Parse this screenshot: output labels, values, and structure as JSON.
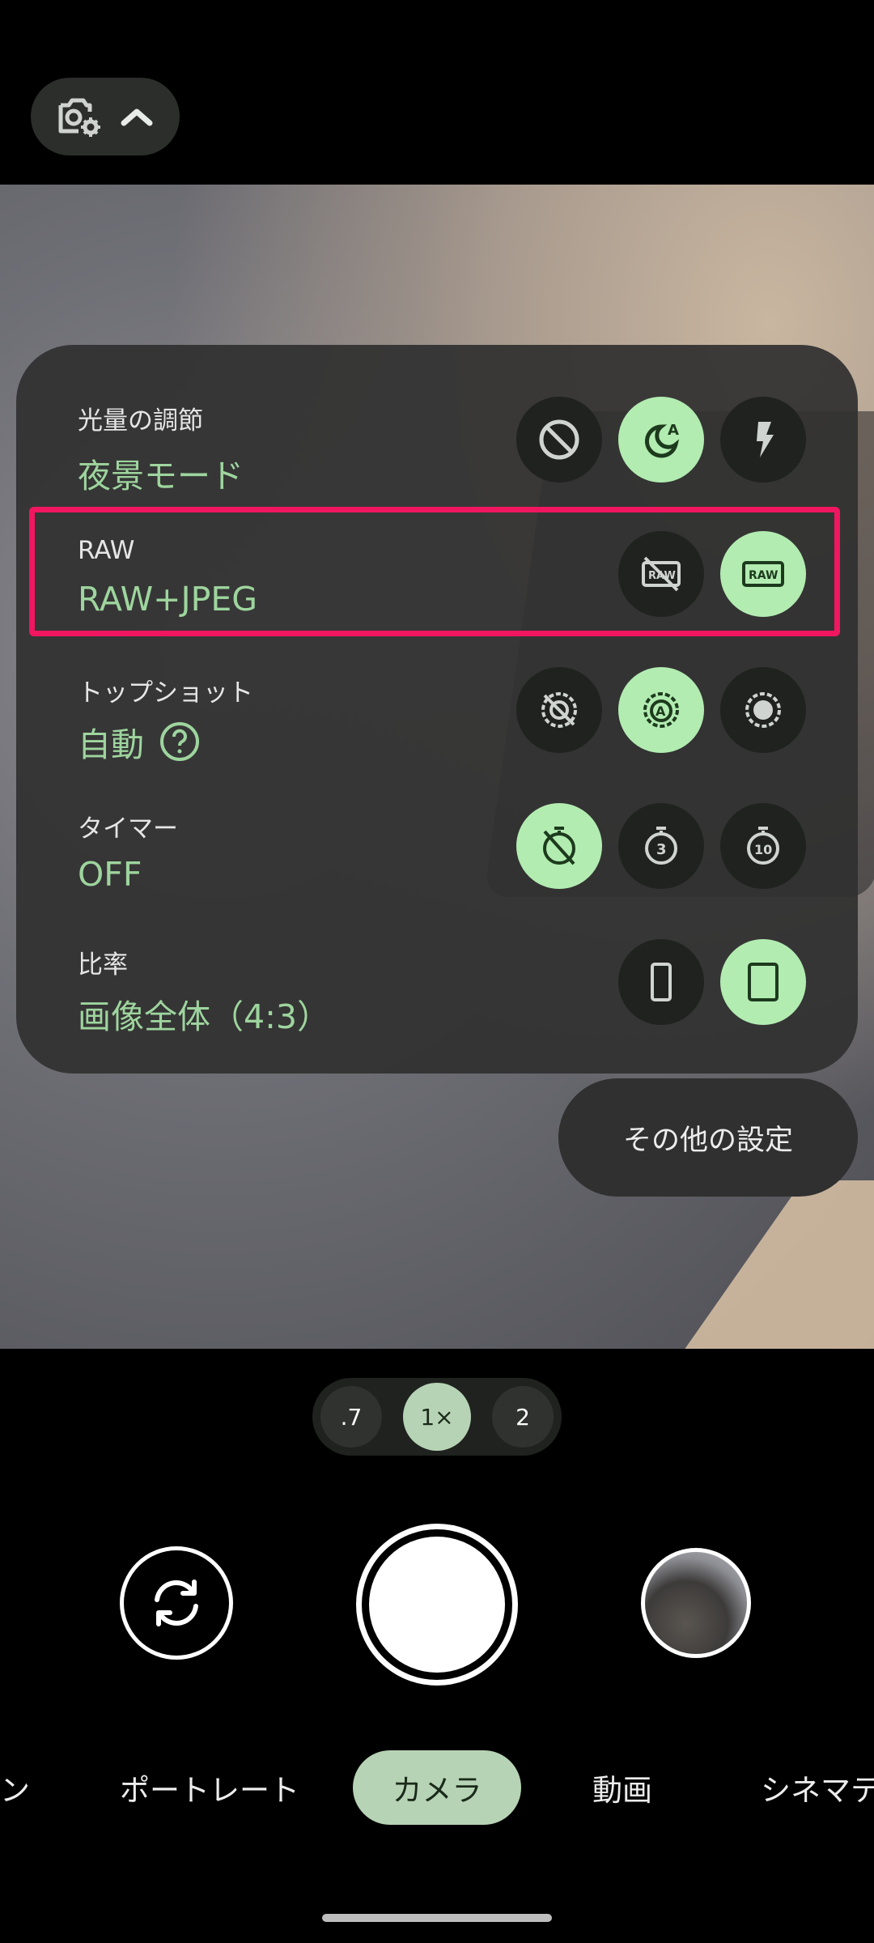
{
  "top_bar": {
    "settings_icon": "camera-settings-icon",
    "chevron_icon": "chevron-up-icon"
  },
  "settings": {
    "rows": [
      {
        "label": "光量の調節",
        "value": "夜景モード"
      },
      {
        "label": "RAW",
        "value": "RAW+JPEG"
      },
      {
        "label": "トップショット",
        "value": "自動"
      },
      {
        "label": "タイマー",
        "value": "OFF"
      },
      {
        "label": "比率",
        "value": "画像全体（4:3）"
      }
    ],
    "accent_color": "#b2ecb1",
    "highlight_color": "#f01660"
  },
  "more_settings": {
    "label": "その他の設定"
  },
  "zoom": {
    "options": [
      ".7",
      "1×",
      "2"
    ],
    "selected": "1×"
  },
  "modes": {
    "items": [
      "ン",
      "ポートレート",
      "カメラ",
      "動画",
      "シネマテ"
    ],
    "selected": "カメラ"
  }
}
